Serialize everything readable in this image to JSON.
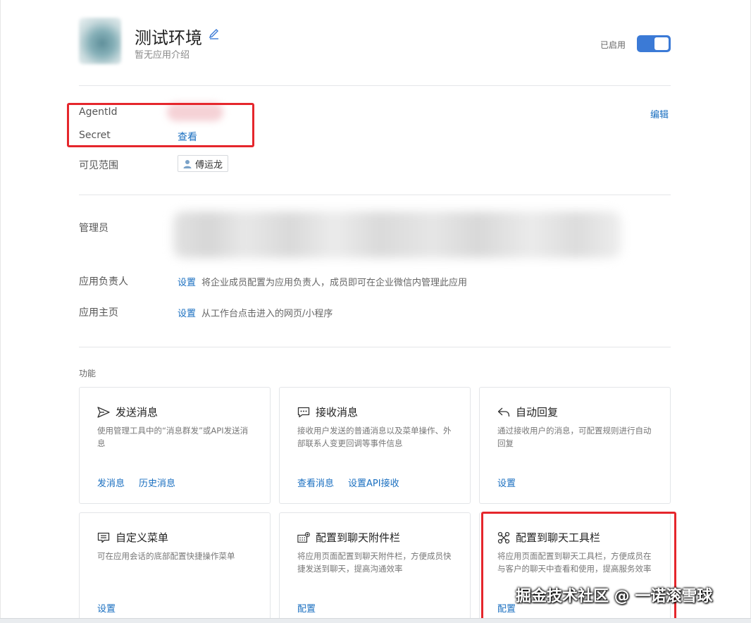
{
  "app": {
    "title": "测试环境",
    "subtitle": "暂无应用介绍",
    "status_label": "已启用",
    "enabled": true
  },
  "info": {
    "agentid_label": "AgentId",
    "secret_label": "Secret",
    "secret_action": "查看",
    "edit_label": "编辑",
    "visibility_label": "可见范围",
    "visibility_user": "傅运龙"
  },
  "admin": {
    "admin_label": "管理员",
    "owner_label": "应用负责人",
    "owner_action": "设置",
    "owner_desc": "将企业成员配置为应用负责人，成员即可在企业微信内管理此应用",
    "homepage_label": "应用主页",
    "homepage_action": "设置",
    "homepage_desc": "从工作台点击进入的网页/小程序"
  },
  "features": {
    "section_label": "功能",
    "cards": [
      {
        "title": "发送消息",
        "icon": "send-icon",
        "desc": "使用管理工具中的“消息群发”或API发送消息",
        "links": [
          "发消息",
          "历史消息"
        ]
      },
      {
        "title": "接收消息",
        "icon": "chat-icon",
        "desc": "接收用户发送的普通消息以及菜单操作、外部联系人变更回调等事件信息",
        "links": [
          "查看消息",
          "设置API接收"
        ]
      },
      {
        "title": "自动回复",
        "icon": "reply-icon",
        "desc": "通过接收用户的消息，可配置规则进行自动回复",
        "links": [
          "设置"
        ]
      },
      {
        "title": "自定义菜单",
        "icon": "menu-icon",
        "desc": "可在应用会话的底部配置快捷操作菜单",
        "links": [
          "设置"
        ]
      },
      {
        "title": "配置到聊天附件栏",
        "icon": "attachment-bar-icon",
        "desc": "将应用页面配置到聊天附件栏，方便成员快捷发送到聊天，提高沟通效率",
        "links": [
          "配置"
        ]
      },
      {
        "title": "配置到聊天工具栏",
        "icon": "toolbar-icon",
        "desc": "将应用页面配置到聊天工具栏，方便成员在与客户的聊天中查看和使用，提高服务效率",
        "links": [
          "配置"
        ]
      }
    ]
  },
  "watermark": "掘金技术社区 @ 一诺滚雪球",
  "colors": {
    "accent": "#1a6fc0",
    "toggle": "#3b7ad6",
    "highlight": "#e5262c"
  }
}
